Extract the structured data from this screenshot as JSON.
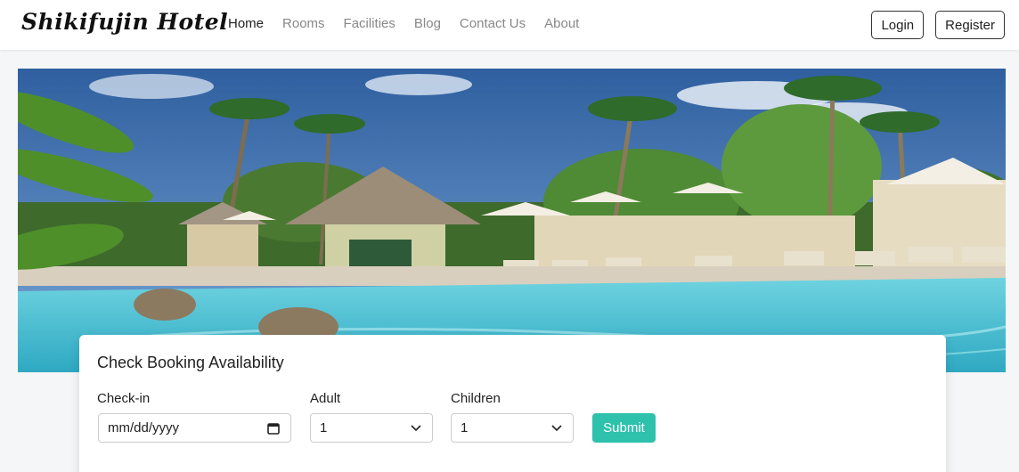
{
  "brand": {
    "name": "Shikifujin Hotel"
  },
  "nav": {
    "links": [
      {
        "label": "Home",
        "active": true
      },
      {
        "label": "Rooms",
        "active": false
      },
      {
        "label": "Facilities",
        "active": false
      },
      {
        "label": "Blog",
        "active": false
      },
      {
        "label": "Contact Us",
        "active": false
      },
      {
        "label": "About",
        "active": false
      }
    ],
    "login_label": "Login",
    "register_label": "Register"
  },
  "hero": {
    "image": "resort-pool-photo"
  },
  "booking": {
    "title": "Check Booking Availability",
    "checkin_label": "Check-in",
    "checkin_value": "mm/dd/yyyy",
    "adult_label": "Adult",
    "adult_value": "1",
    "children_label": "Children",
    "children_value": "1",
    "submit_label": "Submit"
  },
  "colors": {
    "accent": "#2ec1ac",
    "text": "#222222",
    "muted_nav": "#888888"
  }
}
